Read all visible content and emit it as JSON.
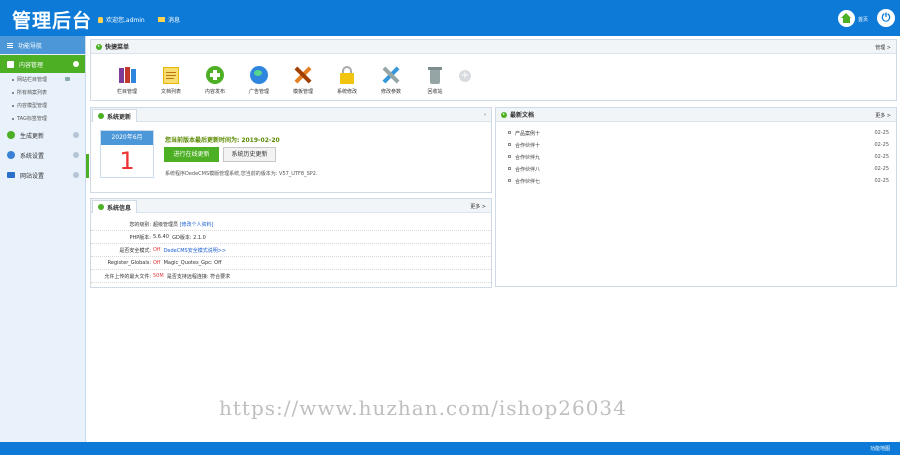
{
  "header": {
    "logo": "管理后台",
    "welcome": "欢迎您,admin",
    "messages": "消息",
    "home_label": "首页",
    "colors": {
      "bar": "#0c7ad6",
      "home": "#4caf24"
    }
  },
  "sidebar": {
    "title": "功能导航",
    "active": "内容管理",
    "subitems": [
      "网站栏目管理",
      "所有档案列表",
      "内容模型管理",
      "TAG标签管理"
    ],
    "sections": [
      {
        "label": "生成更新",
        "icon": "leaf-icon"
      },
      {
        "label": "系统设置",
        "icon": "gear-icon"
      },
      {
        "label": "网站设置",
        "icon": "monitor-icon"
      }
    ]
  },
  "quick": {
    "title": "快捷菜单",
    "manage": "管理 >",
    "items": [
      {
        "label": "栏目管理",
        "icon": "books-icon",
        "color": "#7d3c98"
      },
      {
        "label": "文档列表",
        "icon": "notepad-icon",
        "color": "#e6b800"
      },
      {
        "label": "内容发布",
        "icon": "add-circle-icon",
        "color": "#4caf24"
      },
      {
        "label": "广告管理",
        "icon": "globe-icon",
        "color": "#2e86de"
      },
      {
        "label": "模板管理",
        "icon": "tools-cross-icon",
        "color": "#e67e22"
      },
      {
        "label": "系统修改",
        "icon": "lock-icon",
        "color": "#f1c40f"
      },
      {
        "label": "修改参数",
        "icon": "wrench-icon",
        "color": "#3498db"
      },
      {
        "label": "回收站",
        "icon": "trash-icon",
        "color": "#7f8c8d"
      }
    ]
  },
  "updates": {
    "tab": "系统更新",
    "month": "2020年6月",
    "day": "1",
    "version_text": "您当前版本最后更新时间为:",
    "version_date": "2019-02-20",
    "btn_online": "进行在线更新",
    "btn_history": "系统历史更新",
    "sys_line": "系统程序DedeCMS模版管理系统,您当前的版本为: V57_UTF8_SP2."
  },
  "sysinfo": {
    "tab": "系统信息",
    "more": "更多 >",
    "rows": [
      {
        "k": "您的级别:",
        "v": "超级管理员",
        "extra": "[修改个人资料]"
      },
      {
        "k": "PHP版本:",
        "v": "5.6.40",
        "extra": "GD版本: 2.1.0"
      },
      {
        "k": "是否安全模式:",
        "v": "Off",
        "extra": "DedeCMS安全模式说明>>"
      },
      {
        "k": "Register_Globals:",
        "v": "Off",
        "extra": "Magic_Quotes_Gpc: Off"
      },
      {
        "k": "允许上传的最大文件:",
        "v": "50M",
        "extra": "是否支持远程连接: 符合要求"
      }
    ]
  },
  "news": {
    "title": "最新文档",
    "more": "更多 >",
    "items": [
      {
        "title": "产品案例十",
        "date": "02-25"
      },
      {
        "title": "合作伙伴十",
        "date": "02-25"
      },
      {
        "title": "合作伙伴九",
        "date": "02-25"
      },
      {
        "title": "合作伙伴八",
        "date": "02-25"
      },
      {
        "title": "合作伙伴七",
        "date": "02-25"
      }
    ]
  },
  "watermark": "https://www.huzhan.com/ishop26034",
  "footer": {
    "text": "功能地图"
  }
}
